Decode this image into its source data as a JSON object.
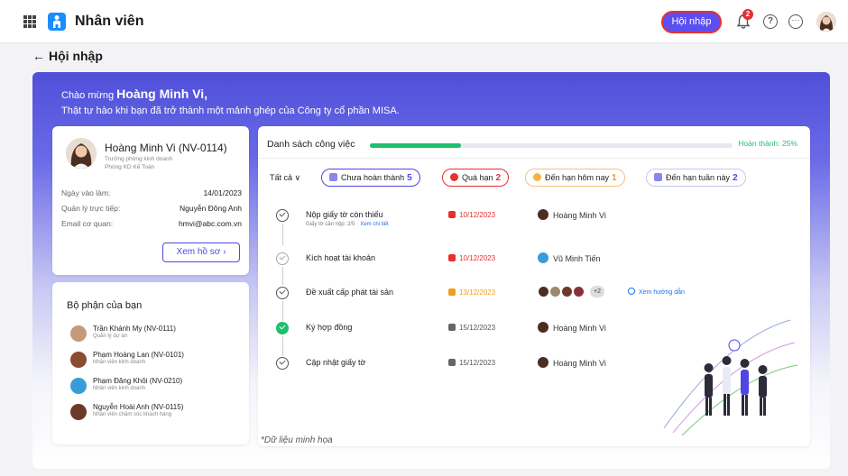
{
  "app": {
    "title": "Nhân viên"
  },
  "topbar": {
    "onboard_button": "Hội nhập",
    "notification_count": "2",
    "help_glyph": "?",
    "more_glyph": "···"
  },
  "page": {
    "title": "Hội nhập"
  },
  "welcome": {
    "greeting_prefix": "Chào mừng ",
    "greeting_name": "Hoàng Minh Vi,",
    "message": "Thật tự hào khi bạn đã trở thành một mảnh ghép của Công ty cổ phần MISA."
  },
  "profile": {
    "name": "Hoàng Minh Vi (NV-0114)",
    "position": "Trưởng phòng kinh doanh",
    "department": "Phòng KD Kế Toán",
    "rows": [
      {
        "label": "Ngày vào làm:",
        "value": "14/01/2023"
      },
      {
        "label": "Quản lý trực tiếp:",
        "value": "Nguyễn Đông Anh"
      },
      {
        "label": "Email cơ quan:",
        "value": "hmvi@abc.com.vn"
      }
    ],
    "button": "Xem hồ sơ ›"
  },
  "department": {
    "title": "Bộ phận của bạn",
    "members": [
      {
        "name": "Trần Khánh My (NV-0111)",
        "role": "Quản lý dự án",
        "avatar_color": "#c49a7a"
      },
      {
        "name": "Phạm Hoàng Lan (NV-0101)",
        "role": "Nhân viên kinh doanh",
        "avatar_color": "#8a4b2f"
      },
      {
        "name": "Phạm Đăng Khôi (NV-0210)",
        "role": "Nhân viên kinh doanh",
        "avatar_color": "#3a9bd9"
      },
      {
        "name": "Nguyễn Hoài Anh (NV-0115)",
        "role": "Nhân viên chăm sóc khách hàng",
        "avatar_color": "#6b3a2a"
      }
    ]
  },
  "tasks": {
    "title": "Danh sách công việc",
    "progress_percent": 25,
    "progress_label": "Hoàn thành: 25%",
    "filter_all": "Tất cả ∨",
    "chips": [
      {
        "label": "Chưa hoàn thành",
        "count": "5",
        "color": "#4f46e5"
      },
      {
        "label": "Quá hạn",
        "count": "2",
        "color": "#e53030"
      },
      {
        "label": "Đến hạn hôm nay",
        "count": "1",
        "color": "#f29c1f"
      },
      {
        "label": "Đến hạn tuần này",
        "count": "2",
        "color": "#4f46e5"
      }
    ],
    "items": [
      {
        "name": "Nộp giấy tờ còn thiếu",
        "sub": "Giấy tờ cần nộp: 2/5",
        "sub_link": "Xem chi tiết",
        "date": "10/12/2023",
        "date_color": "#e53030",
        "owner": "Hoàng Minh Vi",
        "status": "open"
      },
      {
        "name": "Kích hoạt tài khoản",
        "date": "10/12/2023",
        "date_color": "#e53030",
        "owner": "Vũ Minh Tiến",
        "status": "light"
      },
      {
        "name": "Đề xuất cấp phát tài sản",
        "date": "13/12/2023",
        "date_color": "#f29c1f",
        "extra": "+2",
        "guide": "Xem hướng dẫn",
        "status": "open"
      },
      {
        "name": "Ký hợp đồng",
        "date": "15/12/2023",
        "date_color": "#555555",
        "owner": "Hoàng Minh Vi",
        "status": "done"
      },
      {
        "name": "Cập nhật giấy tờ",
        "date": "15/12/2023",
        "date_color": "#555555",
        "owner": "Hoàng Minh Vi",
        "status": "open"
      }
    ]
  },
  "footnote": "*Dữ liệu minh họa",
  "colors": {
    "accent": "#4f46e5",
    "success": "#1fbf6b",
    "danger": "#e53030",
    "warning": "#f29c1f"
  },
  "icons": [
    "apps-grid-icon",
    "person-app-icon",
    "bell-icon",
    "help-icon",
    "more-icon",
    "back-arrow-icon",
    "calendar-icon",
    "check-circle-icon",
    "lightbulb-icon"
  ]
}
